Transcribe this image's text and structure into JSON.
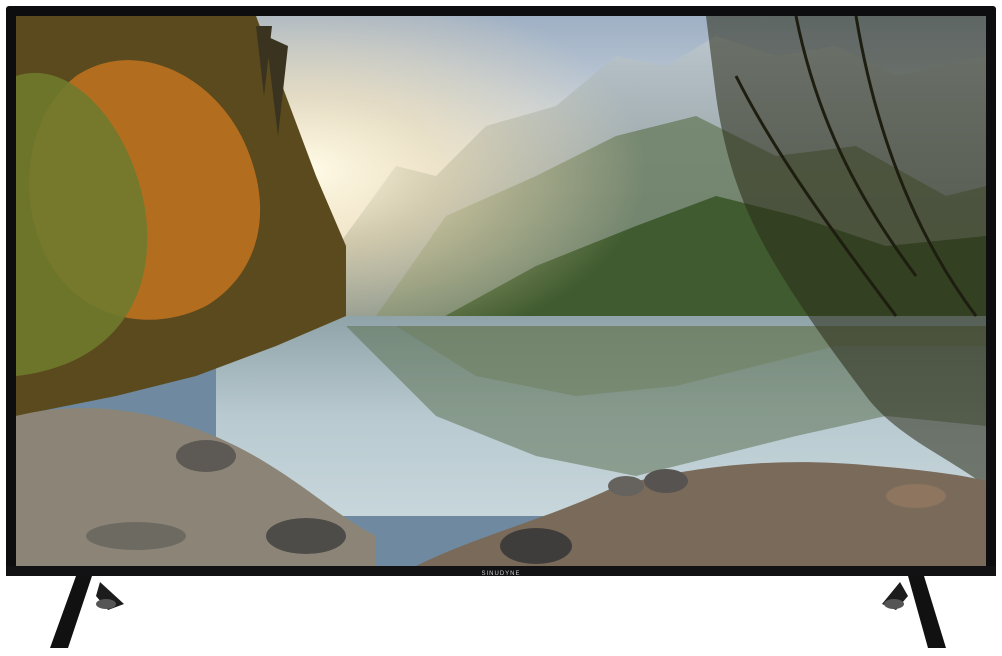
{
  "image": {
    "description_icon": "television-icon",
    "brand_text": "SINUDYNE",
    "colors": {
      "bezel": "#0d0d0f",
      "sky": "#bfc9d6",
      "water": "#9fb3c0",
      "forest": "#3e5c2a",
      "autumn": "#c7741f"
    }
  }
}
